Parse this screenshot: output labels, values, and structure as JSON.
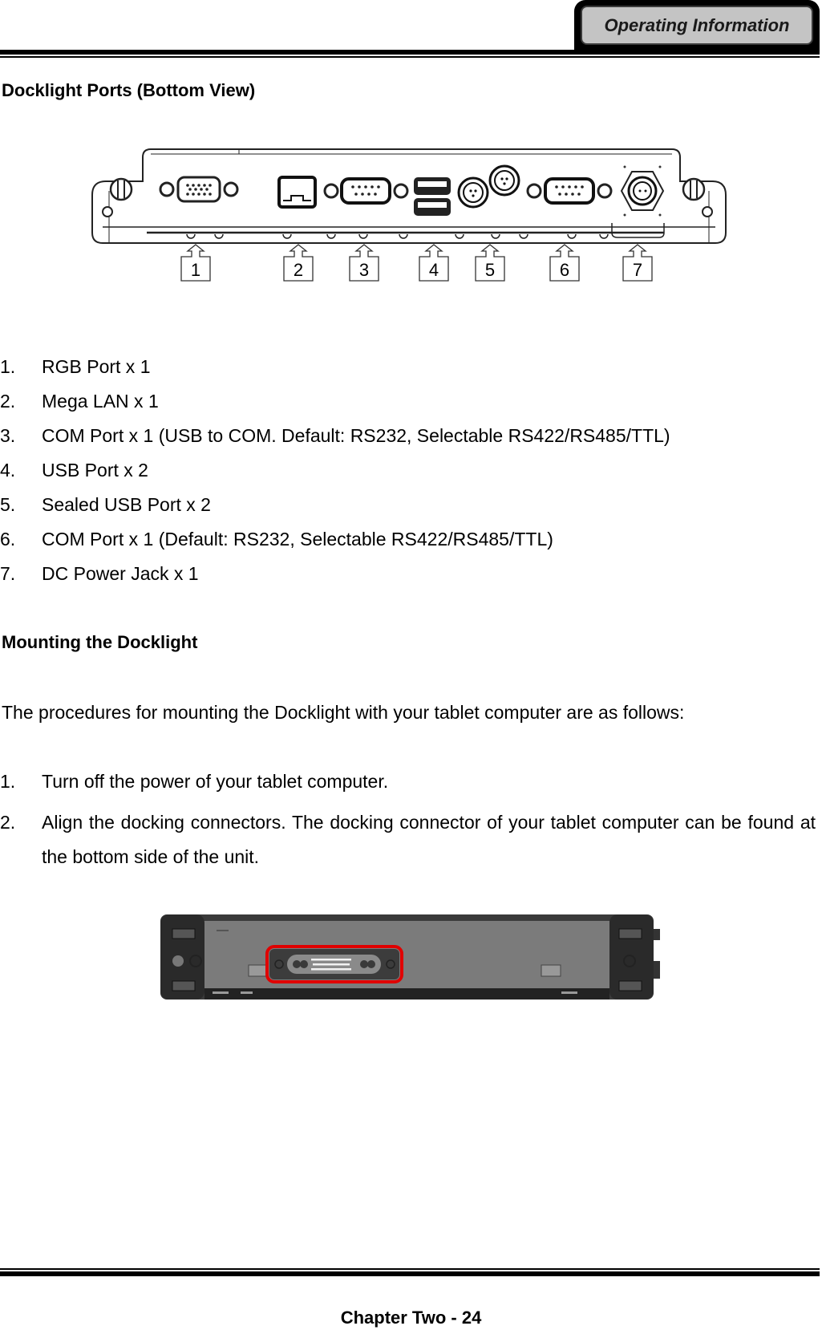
{
  "header": {
    "section_tab": "Operating Information"
  },
  "docklight_ports": {
    "title": "Docklight Ports (Bottom View)",
    "figure": {
      "description": "Docklight bottom view line drawing with numbered callouts",
      "callouts": [
        "1",
        "2",
        "3",
        "4",
        "5",
        "6",
        "7"
      ]
    },
    "items": [
      {
        "num": "1.",
        "text": "RGB Port x 1"
      },
      {
        "num": "2.",
        "text": "Mega LAN x 1"
      },
      {
        "num": "3.",
        "text": "COM Port x 1 (USB to COM. Default: RS232, Selectable RS422/RS485/TTL)"
      },
      {
        "num": "4.",
        "text": "USB Port x 2"
      },
      {
        "num": "5.",
        "text": "Sealed USB Port x 2"
      },
      {
        "num": "6.",
        "text": "COM Port x 1 (Default: RS232, Selectable RS422/RS485/TTL)"
      },
      {
        "num": "7.",
        "text": "DC Power Jack x 1"
      }
    ]
  },
  "mounting": {
    "title": "Mounting the Docklight",
    "intro": "The procedures for mounting the Docklight with your tablet computer are as follows:",
    "steps": [
      {
        "num": "1.",
        "text": "Turn off the power of your tablet computer."
      },
      {
        "num": "2.",
        "text": "Align the docking connectors. The docking connector of your tablet computer can be found at the bottom side of the unit."
      }
    ],
    "figure": {
      "description": "Tablet bottom side with docking connector highlighted",
      "highlight_color": "#e00000"
    }
  },
  "footer": {
    "page_label": "Chapter Two - 24"
  }
}
